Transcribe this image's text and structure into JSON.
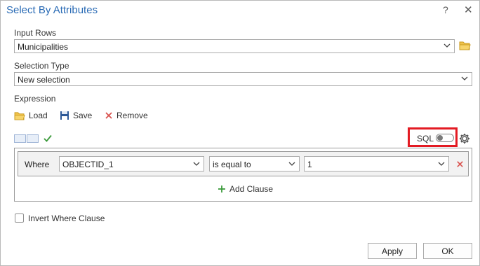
{
  "dialog": {
    "title": "Select By Attributes",
    "help": "?",
    "close": "✕"
  },
  "input_rows": {
    "label": "Input Rows",
    "value": "Municipalities"
  },
  "selection_type": {
    "label": "Selection Type",
    "value": "New selection"
  },
  "expression": {
    "label": "Expression",
    "load": "Load",
    "save": "Save",
    "remove": "Remove",
    "sql_label": "SQL",
    "sql_enabled": false,
    "clause": {
      "where": "Where",
      "field": "OBJECTID_1",
      "operator": "is equal to",
      "value": "1"
    },
    "add_clause": "Add Clause"
  },
  "invert": {
    "label": "Invert Where Clause",
    "checked": false
  },
  "buttons": {
    "apply": "Apply",
    "ok": "OK"
  },
  "colors": {
    "title": "#2a6bb5",
    "highlight": "#e31b23",
    "folder": "#e8b32a",
    "save": "#2b5797",
    "remove": "#d9534f",
    "add": "#3a9a3a",
    "check": "#3a9a3a"
  }
}
